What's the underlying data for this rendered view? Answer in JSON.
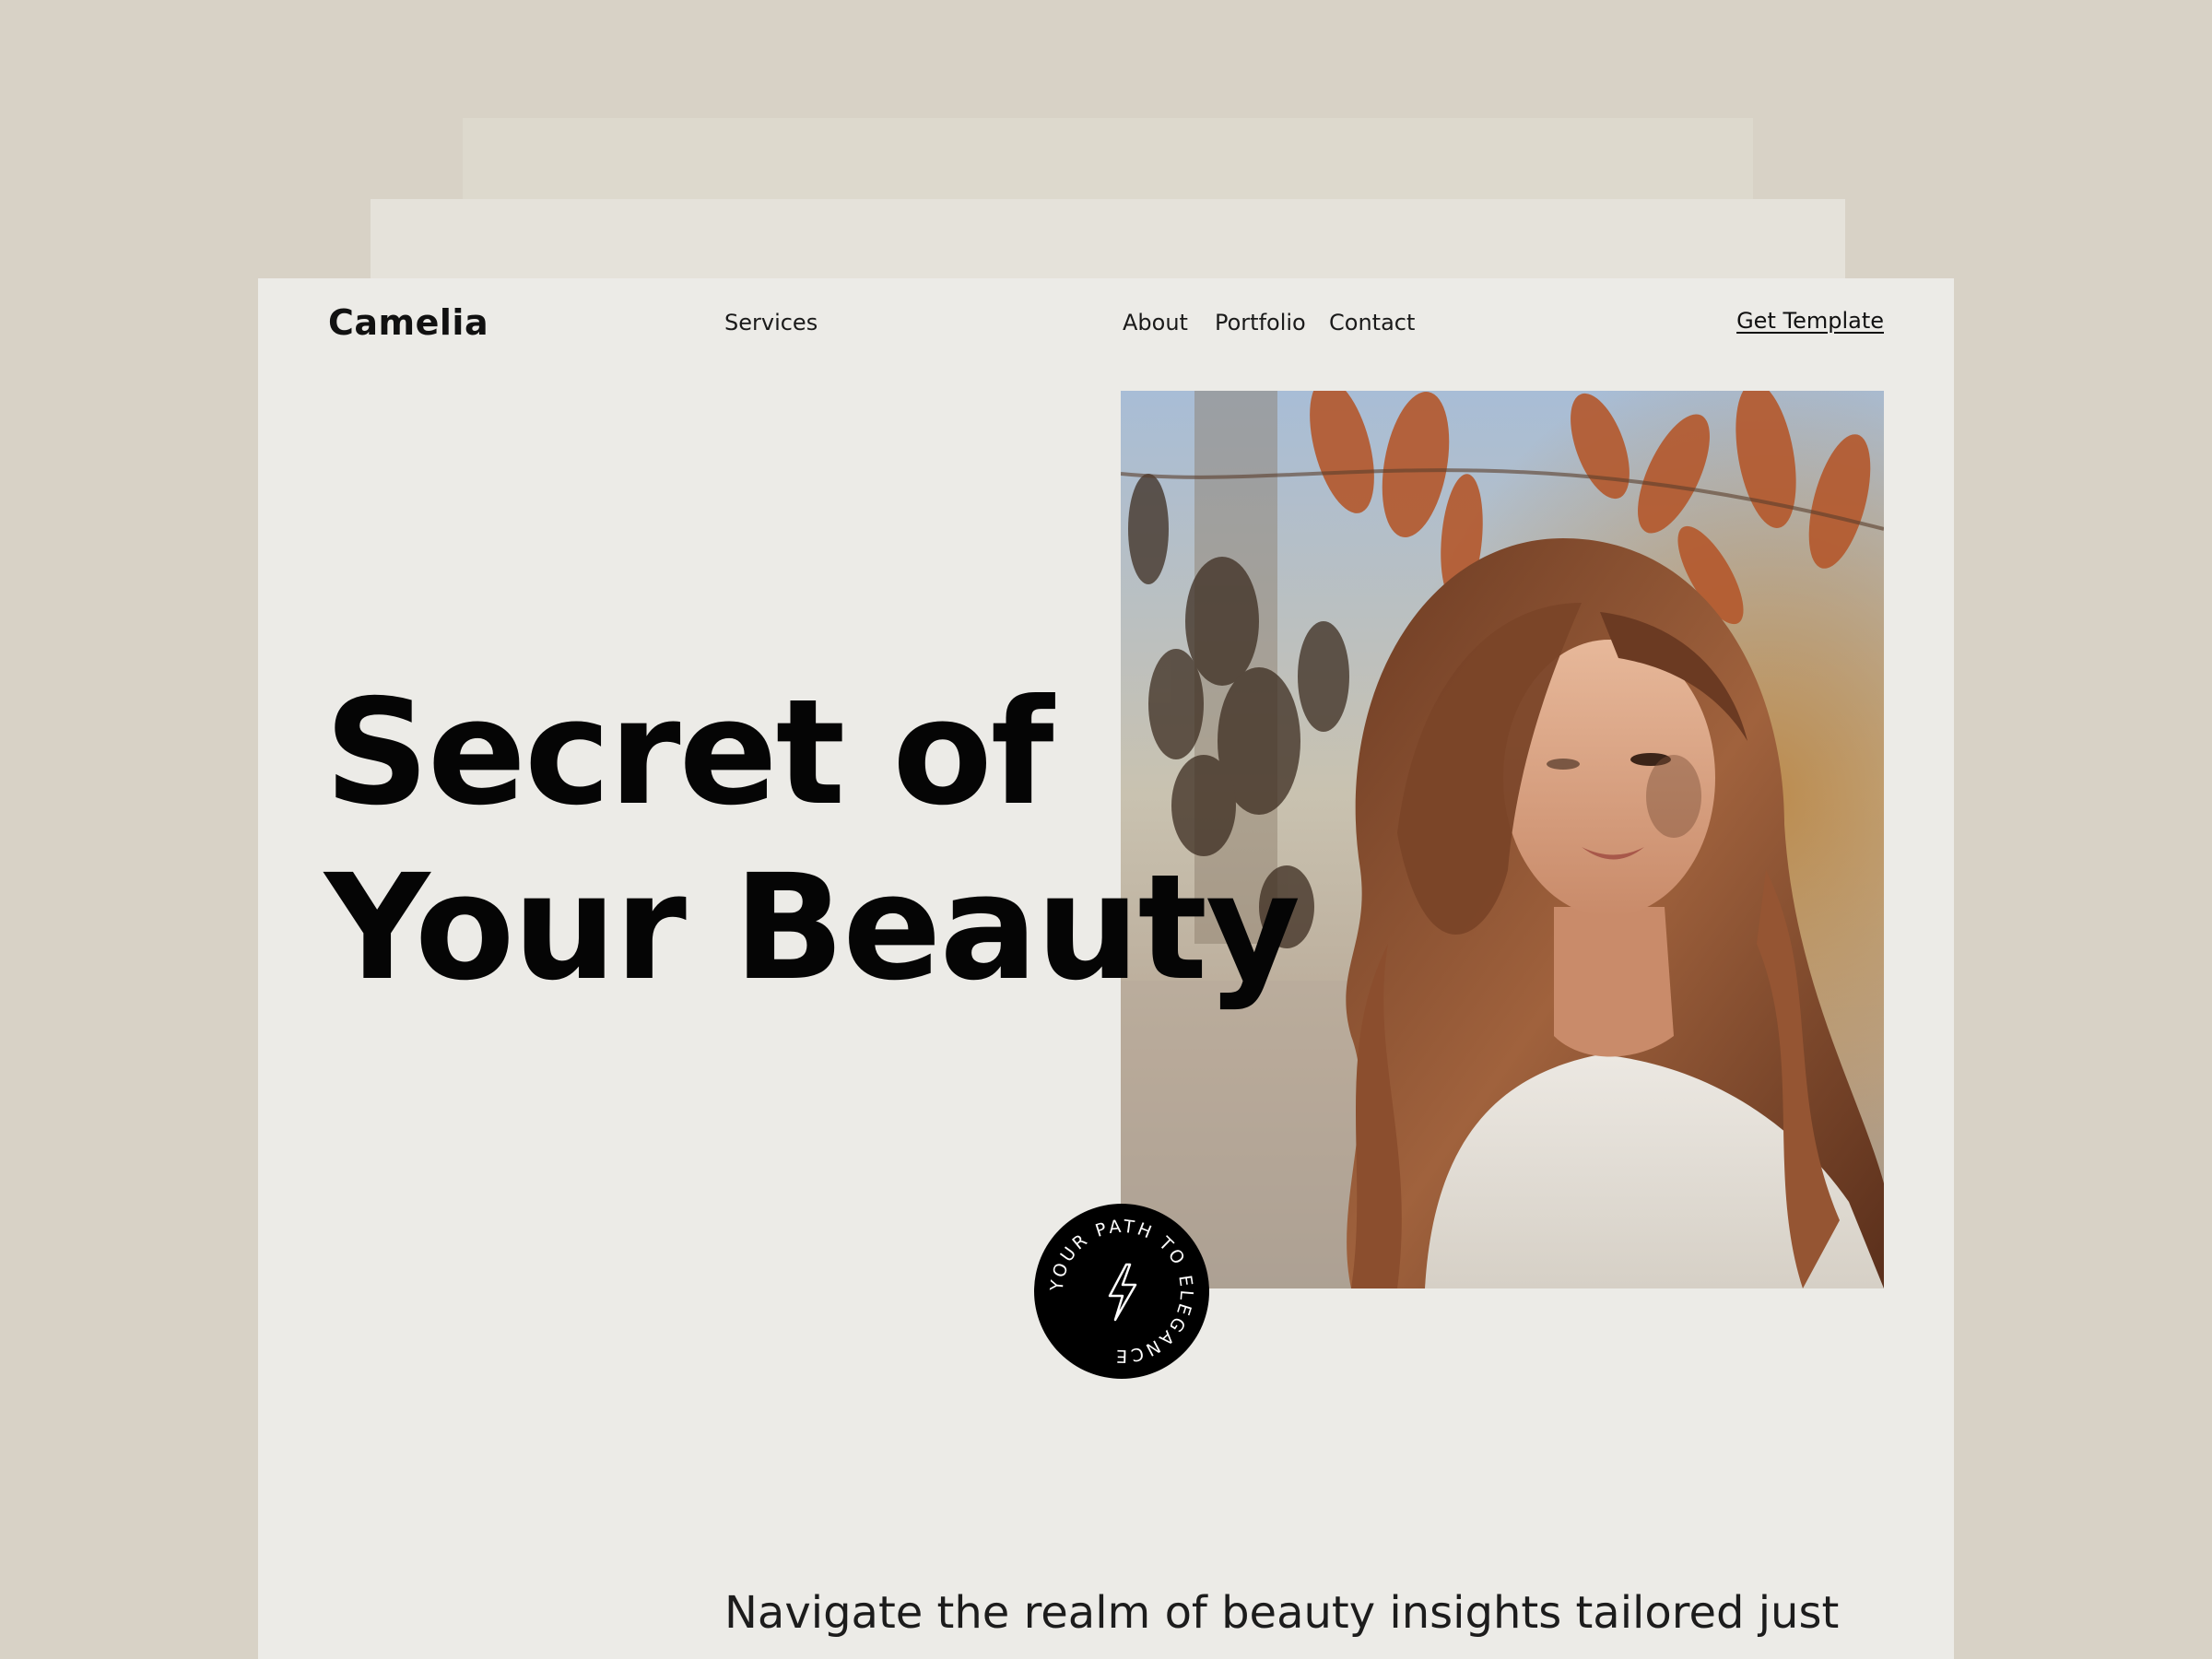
{
  "header": {
    "brand": "Camelia",
    "nav": [
      {
        "label": "Services"
      },
      {
        "label": "About"
      },
      {
        "label": "Portfolio"
      },
      {
        "label": "Contact"
      }
    ],
    "cta_label": "Get Template"
  },
  "hero": {
    "headline_line1": "Secret of",
    "headline_line2": "Your Beauty",
    "badge_text": "YOUR PATH TO ELEGANCE",
    "badge_icon": "lightning-bolt-icon",
    "intro": "Navigate the realm of beauty insights tailored just"
  },
  "colors": {
    "background": "#d8d2c6",
    "page": "#ecebe7",
    "text": "#050505",
    "badge": "#000000"
  }
}
